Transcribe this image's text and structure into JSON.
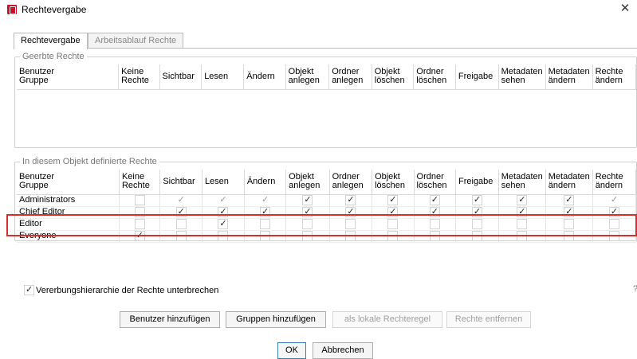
{
  "window": {
    "title": "Rechtevergabe",
    "close_glyph": "✕"
  },
  "tabs": [
    {
      "label": "Rechtevergabe",
      "active": true
    },
    {
      "label": "Arbeitsablauf Rechte",
      "active": false
    }
  ],
  "columns": [
    {
      "line1": "Benutzer",
      "line2": "Gruppe"
    },
    {
      "line1": "Keine",
      "line2": "Rechte"
    },
    {
      "line1": "Sichtbar",
      "line2": ""
    },
    {
      "line1": "Lesen",
      "line2": ""
    },
    {
      "line1": "Ändern",
      "line2": ""
    },
    {
      "line1": "Objekt",
      "line2": "anlegen"
    },
    {
      "line1": "Ordner",
      "line2": "anlegen"
    },
    {
      "line1": "Objekt",
      "line2": "löschen"
    },
    {
      "line1": "Ordner",
      "line2": "löschen"
    },
    {
      "line1": "Freigabe",
      "line2": ""
    },
    {
      "line1": "Metadaten",
      "line2": "sehen"
    },
    {
      "line1": "Metadaten",
      "line2": "ändern"
    },
    {
      "line1": "Rechte",
      "line2": "ändern"
    }
  ],
  "inherited": {
    "legend": "Geerbte Rechte",
    "rows": []
  },
  "defined": {
    "legend": "In diesem Objekt definierte Rechte",
    "rows": [
      {
        "name": "Administrators",
        "rights": [
          0,
          1,
          1,
          1,
          1,
          1,
          1,
          1,
          1,
          1,
          1,
          1
        ],
        "dim": [
          0,
          1,
          1,
          1,
          0,
          0,
          0,
          0,
          0,
          0,
          0,
          1
        ]
      },
      {
        "name": "Chief Editor",
        "rights": [
          0,
          1,
          1,
          1,
          1,
          1,
          1,
          1,
          1,
          1,
          1,
          1
        ],
        "dim": [
          0,
          0,
          0,
          0,
          0,
          0,
          0,
          0,
          0,
          0,
          0,
          0
        ]
      },
      {
        "name": "Editor",
        "rights": [
          0,
          0,
          1,
          0,
          0,
          0,
          0,
          0,
          0,
          0,
          0,
          0
        ],
        "dim": [
          0,
          0,
          0,
          0,
          0,
          0,
          0,
          0,
          0,
          0,
          0,
          0
        ]
      },
      {
        "name": "Everyone",
        "rights": [
          1,
          0,
          0,
          0,
          0,
          0,
          0,
          0,
          0,
          0,
          0,
          0
        ],
        "dim": [
          0,
          0,
          0,
          0,
          0,
          0,
          0,
          0,
          0,
          0,
          0,
          0
        ]
      }
    ]
  },
  "inherit_break": {
    "label": "Vererbungshierarchie der Rechte unterbrechen",
    "checked": true
  },
  "help_glyph": "?",
  "buttons": {
    "add_user": "Benutzer hinzufügen",
    "add_group": "Gruppen hinzufügen",
    "local_rule": "als lokale Rechteregel",
    "remove_rights": "Rechte entfernen",
    "ok": "OK",
    "cancel": "Abbrechen"
  }
}
